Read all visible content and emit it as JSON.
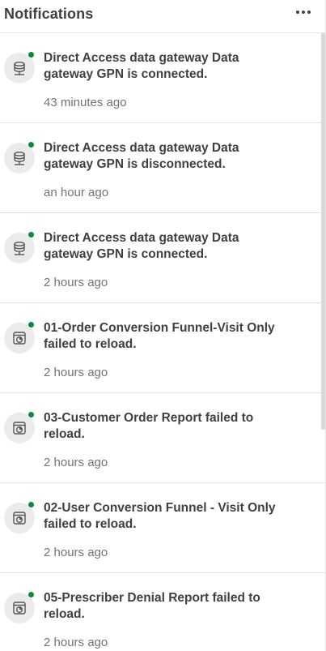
{
  "header": {
    "title": "Notifications",
    "more_icon": "more-horizontal-icon"
  },
  "notifications": [
    {
      "icon": "database-icon",
      "unread": true,
      "text": "Direct Access data gateway Data gateway GPN is connected.",
      "time": "43 minutes ago"
    },
    {
      "icon": "database-icon",
      "unread": true,
      "text": "Direct Access data gateway Data gateway GPN is disconnected.",
      "time": "an hour ago"
    },
    {
      "icon": "database-icon",
      "unread": true,
      "text": "Direct Access data gateway Data gateway GPN is connected.",
      "time": "2 hours ago"
    },
    {
      "icon": "app-reload-icon",
      "unread": true,
      "text": "01-Order Conversion Funnel-Visit Only failed to reload.",
      "time": "2 hours ago"
    },
    {
      "icon": "app-reload-icon",
      "unread": true,
      "text": "03-Customer Order Report failed to reload.",
      "time": "2 hours ago"
    },
    {
      "icon": "app-reload-icon",
      "unread": true,
      "text": "02-User Conversion Funnel - Visit Only failed to reload.",
      "time": "2 hours ago"
    },
    {
      "icon": "app-reload-icon",
      "unread": true,
      "text": "05-Prescriber Denial Report failed to reload.",
      "time": "2 hours ago"
    }
  ],
  "colors": {
    "unread_dot": "#0a8a3c",
    "icon_bg": "#ebebeb",
    "text": "#404040",
    "muted": "#737373"
  }
}
